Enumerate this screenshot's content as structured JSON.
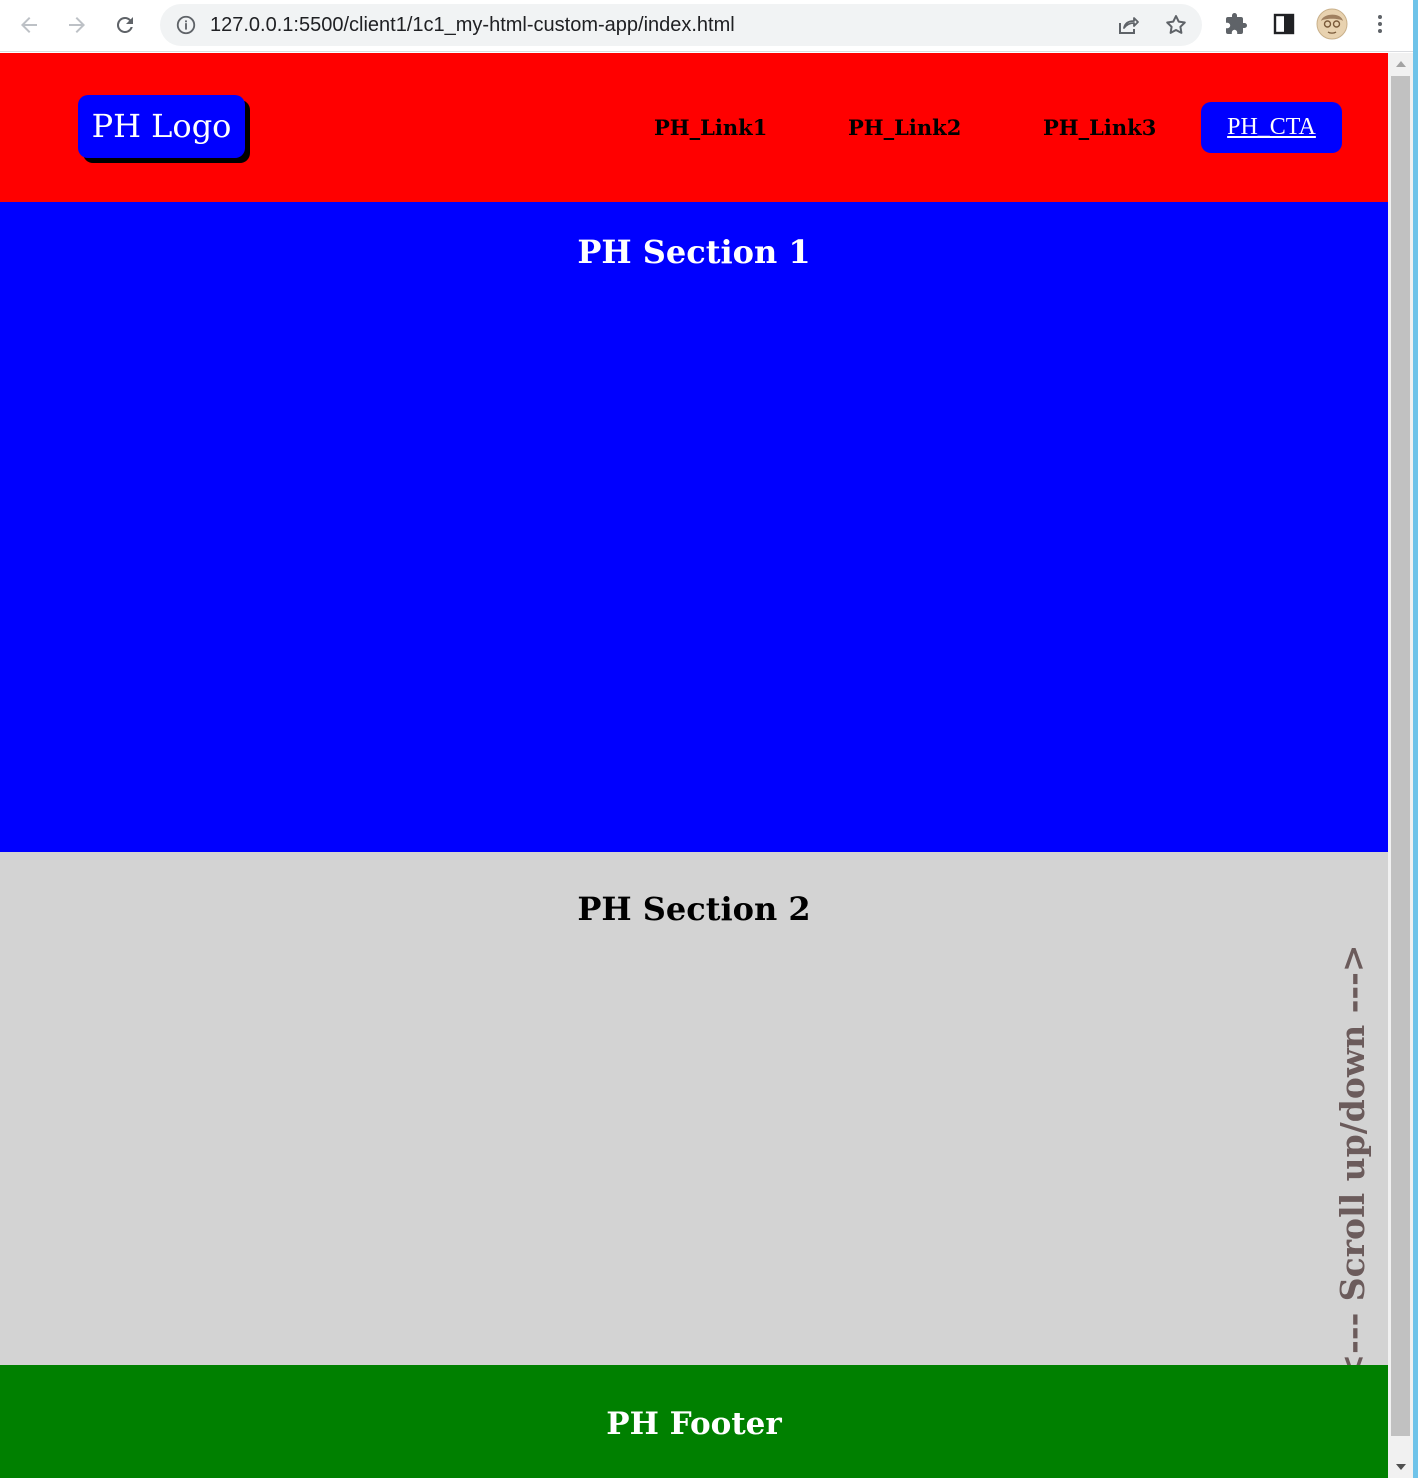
{
  "browser": {
    "url": "127.0.0.1:5500/client1/1c1_my-html-custom-app/index.html",
    "icons": {
      "back": "back-arrow-icon",
      "forward": "forward-arrow-icon",
      "reload": "reload-icon",
      "site_info": "info-icon",
      "share": "share-icon",
      "bookmark": "star-icon",
      "extensions": "puzzle-icon",
      "side_panel": "side-panel-icon",
      "profile": "avatar",
      "menu": "kebab-menu-icon"
    }
  },
  "header": {
    "logo": "PH Logo",
    "nav": [
      {
        "label": "PH_Link1"
      },
      {
        "label": "PH_Link2"
      },
      {
        "label": "PH_Link3"
      }
    ],
    "cta": "PH_CTA"
  },
  "sections": [
    {
      "title": "PH Section 1"
    },
    {
      "title": "PH Section 2"
    }
  ],
  "scroll_hint": "<--- Scroll up/down --->",
  "footer": {
    "title": "PH Footer"
  },
  "colors": {
    "header_bg": "#ff0000",
    "logo_bg": "#0000ff",
    "cta_bg": "#0000ff",
    "section1_bg": "#0000ff",
    "section2_bg": "#d3d3d3",
    "footer_bg": "#008000"
  }
}
